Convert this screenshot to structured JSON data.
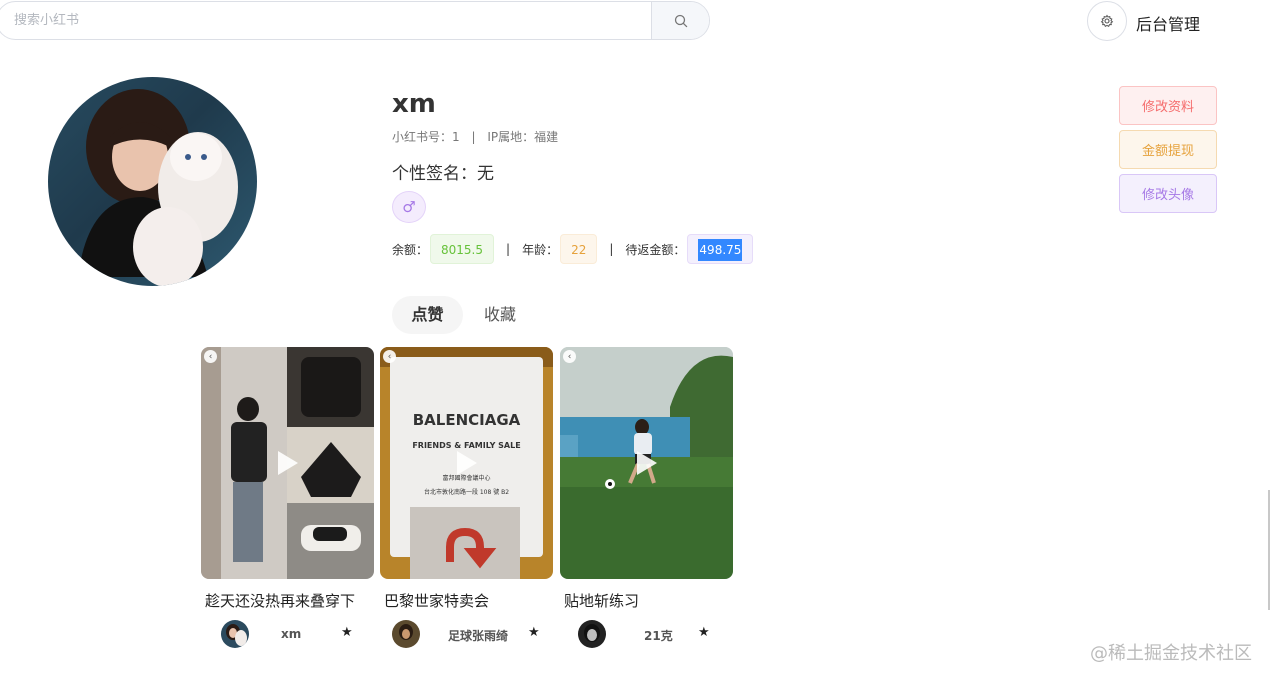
{
  "search": {
    "placeholder": "搜索小红书"
  },
  "header": {
    "admin_label": "后台管理"
  },
  "profile": {
    "username": "xm",
    "id_label": "小红书号：1",
    "ip_label": "IP属地：福建",
    "bio": "个性签名：无",
    "gender_symbol": "♂",
    "balance_label": "余额：",
    "balance_value": "8015.5",
    "age_label": "年龄：",
    "age_value": "22",
    "pending_label": "待返金额：",
    "pending_value": "498.75",
    "separator": "|"
  },
  "actions": {
    "edit_profile": "修改资料",
    "withdraw": "金额提现",
    "edit_avatar": "修改头像"
  },
  "tabs": [
    {
      "label": "点赞",
      "active": true
    },
    {
      "label": "收藏",
      "active": false
    }
  ],
  "cards": [
    {
      "title": "趁天还没热再来叠穿下",
      "author": "xm",
      "overlay_text": []
    },
    {
      "title": "巴黎世家特卖会",
      "author": "足球张雨绮",
      "overlay_text": [
        "BALENCIAGA",
        "FRIENDS & FAMILY SALE",
        "富邦國際會議中心",
        "台北市敦化南路一段 108 號 B2"
      ]
    },
    {
      "title": "贴地斩练习",
      "author": "21克",
      "overlay_text": []
    }
  ],
  "icons": {
    "search": "search-icon",
    "settings": "gear-icon",
    "star": "star-icon",
    "back": "chevron-left-icon",
    "play": "play-icon"
  },
  "colors": {
    "selection": "#3388ff",
    "danger": "#f56c6c",
    "warning": "#e6a23c",
    "purple": "#a679e6",
    "success": "#67c23a"
  },
  "watermark": "@稀土掘金技术社区"
}
